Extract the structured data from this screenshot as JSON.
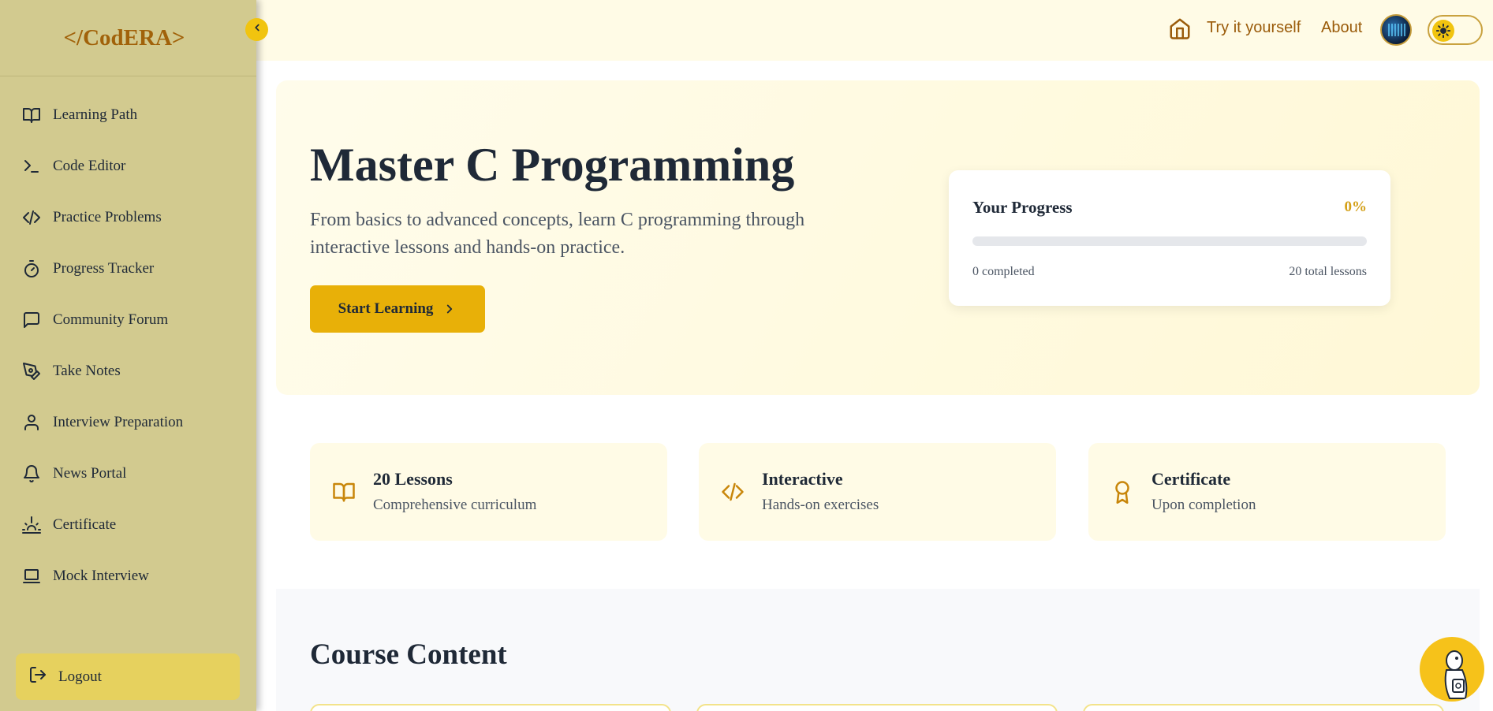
{
  "sidebar": {
    "logo": "</CodERA>",
    "items": [
      {
        "label": "Learning Path",
        "icon": "book-open-icon"
      },
      {
        "label": "Code Editor",
        "icon": "terminal-icon"
      },
      {
        "label": "Practice Problems",
        "icon": "code-icon"
      },
      {
        "label": "Progress Tracker",
        "icon": "timer-icon"
      },
      {
        "label": "Community Forum",
        "icon": "message-square-icon"
      },
      {
        "label": "Take Notes",
        "icon": "pen-tool-icon"
      },
      {
        "label": "Interview Preparation",
        "icon": "user-icon"
      },
      {
        "label": "News Portal",
        "icon": "bell-icon"
      },
      {
        "label": "Certificate",
        "icon": "sunrise-icon"
      },
      {
        "label": "Mock Interview",
        "icon": "laptop-icon"
      }
    ],
    "logout_label": "Logout"
  },
  "header": {
    "try_label": "Try it yourself",
    "about_label": "About"
  },
  "hero": {
    "title": "Master C Programming",
    "subtitle": "From basics to advanced concepts, learn C programming through interactive lessons and hands-on practice.",
    "start_label": "Start Learning"
  },
  "progress": {
    "title": "Your Progress",
    "percent_label": "0%",
    "fraction": 0,
    "completed_label": "0 completed",
    "total_label": "20 total lessons"
  },
  "features": [
    {
      "title": "20 Lessons",
      "subtitle": "Comprehensive curriculum",
      "icon": "book-open-icon"
    },
    {
      "title": "Interactive",
      "subtitle": "Hands-on exercises",
      "icon": "code-icon"
    },
    {
      "title": "Certificate",
      "subtitle": "Upon completion",
      "icon": "award-icon"
    }
  ],
  "course": {
    "title": "Course Content"
  },
  "colors": {
    "sidebar_bg": "#d2ca8f",
    "accent": "#e8b008",
    "brand": "#a1620a"
  }
}
